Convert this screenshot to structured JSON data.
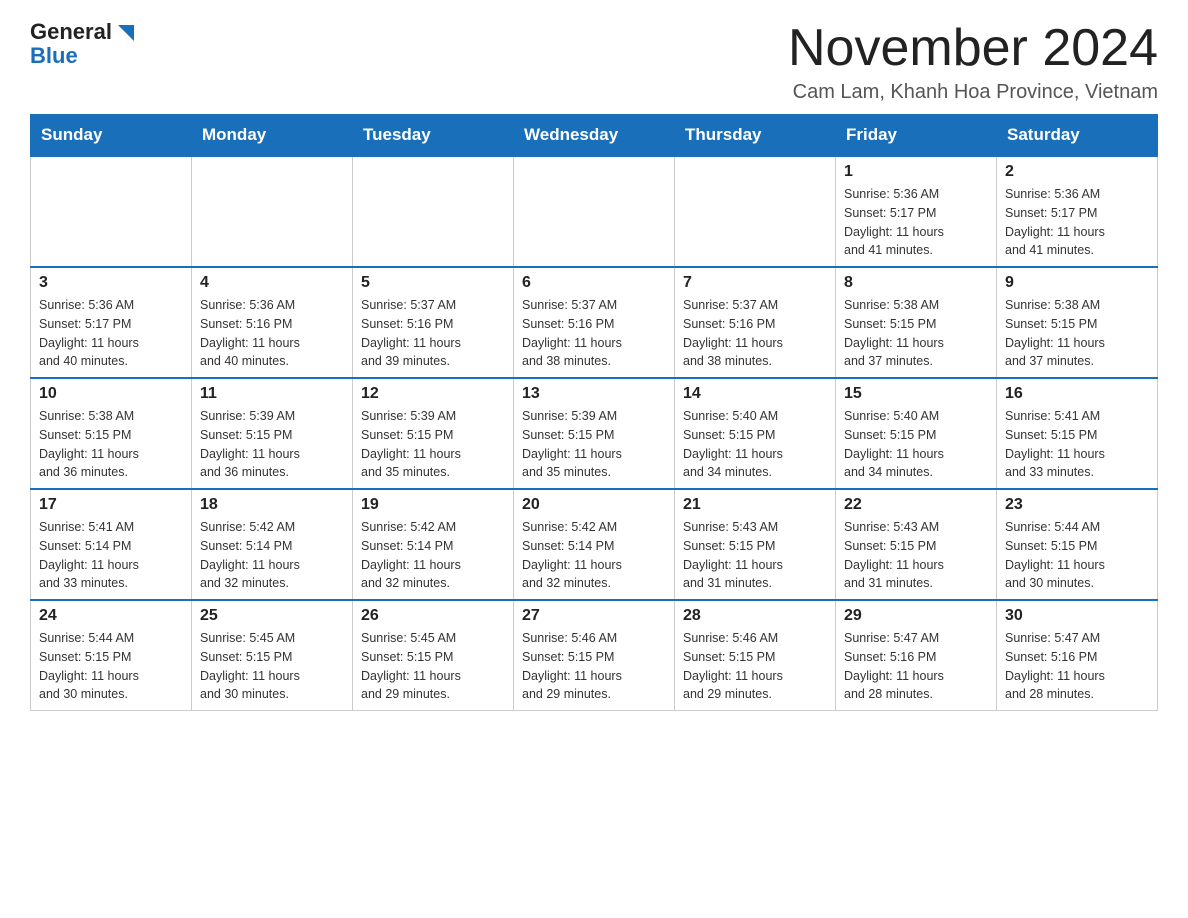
{
  "header": {
    "logo_general": "General",
    "logo_blue": "Blue",
    "month_title": "November 2024",
    "location": "Cam Lam, Khanh Hoa Province, Vietnam"
  },
  "days_of_week": [
    "Sunday",
    "Monday",
    "Tuesday",
    "Wednesday",
    "Thursday",
    "Friday",
    "Saturday"
  ],
  "weeks": [
    {
      "days": [
        {
          "date": "",
          "info": ""
        },
        {
          "date": "",
          "info": ""
        },
        {
          "date": "",
          "info": ""
        },
        {
          "date": "",
          "info": ""
        },
        {
          "date": "",
          "info": ""
        },
        {
          "date": "1",
          "info": "Sunrise: 5:36 AM\nSunset: 5:17 PM\nDaylight: 11 hours\nand 41 minutes."
        },
        {
          "date": "2",
          "info": "Sunrise: 5:36 AM\nSunset: 5:17 PM\nDaylight: 11 hours\nand 41 minutes."
        }
      ]
    },
    {
      "days": [
        {
          "date": "3",
          "info": "Sunrise: 5:36 AM\nSunset: 5:17 PM\nDaylight: 11 hours\nand 40 minutes."
        },
        {
          "date": "4",
          "info": "Sunrise: 5:36 AM\nSunset: 5:16 PM\nDaylight: 11 hours\nand 40 minutes."
        },
        {
          "date": "5",
          "info": "Sunrise: 5:37 AM\nSunset: 5:16 PM\nDaylight: 11 hours\nand 39 minutes."
        },
        {
          "date": "6",
          "info": "Sunrise: 5:37 AM\nSunset: 5:16 PM\nDaylight: 11 hours\nand 38 minutes."
        },
        {
          "date": "7",
          "info": "Sunrise: 5:37 AM\nSunset: 5:16 PM\nDaylight: 11 hours\nand 38 minutes."
        },
        {
          "date": "8",
          "info": "Sunrise: 5:38 AM\nSunset: 5:15 PM\nDaylight: 11 hours\nand 37 minutes."
        },
        {
          "date": "9",
          "info": "Sunrise: 5:38 AM\nSunset: 5:15 PM\nDaylight: 11 hours\nand 37 minutes."
        }
      ]
    },
    {
      "days": [
        {
          "date": "10",
          "info": "Sunrise: 5:38 AM\nSunset: 5:15 PM\nDaylight: 11 hours\nand 36 minutes."
        },
        {
          "date": "11",
          "info": "Sunrise: 5:39 AM\nSunset: 5:15 PM\nDaylight: 11 hours\nand 36 minutes."
        },
        {
          "date": "12",
          "info": "Sunrise: 5:39 AM\nSunset: 5:15 PM\nDaylight: 11 hours\nand 35 minutes."
        },
        {
          "date": "13",
          "info": "Sunrise: 5:39 AM\nSunset: 5:15 PM\nDaylight: 11 hours\nand 35 minutes."
        },
        {
          "date": "14",
          "info": "Sunrise: 5:40 AM\nSunset: 5:15 PM\nDaylight: 11 hours\nand 34 minutes."
        },
        {
          "date": "15",
          "info": "Sunrise: 5:40 AM\nSunset: 5:15 PM\nDaylight: 11 hours\nand 34 minutes."
        },
        {
          "date": "16",
          "info": "Sunrise: 5:41 AM\nSunset: 5:15 PM\nDaylight: 11 hours\nand 33 minutes."
        }
      ]
    },
    {
      "days": [
        {
          "date": "17",
          "info": "Sunrise: 5:41 AM\nSunset: 5:14 PM\nDaylight: 11 hours\nand 33 minutes."
        },
        {
          "date": "18",
          "info": "Sunrise: 5:42 AM\nSunset: 5:14 PM\nDaylight: 11 hours\nand 32 minutes."
        },
        {
          "date": "19",
          "info": "Sunrise: 5:42 AM\nSunset: 5:14 PM\nDaylight: 11 hours\nand 32 minutes."
        },
        {
          "date": "20",
          "info": "Sunrise: 5:42 AM\nSunset: 5:14 PM\nDaylight: 11 hours\nand 32 minutes."
        },
        {
          "date": "21",
          "info": "Sunrise: 5:43 AM\nSunset: 5:15 PM\nDaylight: 11 hours\nand 31 minutes."
        },
        {
          "date": "22",
          "info": "Sunrise: 5:43 AM\nSunset: 5:15 PM\nDaylight: 11 hours\nand 31 minutes."
        },
        {
          "date": "23",
          "info": "Sunrise: 5:44 AM\nSunset: 5:15 PM\nDaylight: 11 hours\nand 30 minutes."
        }
      ]
    },
    {
      "days": [
        {
          "date": "24",
          "info": "Sunrise: 5:44 AM\nSunset: 5:15 PM\nDaylight: 11 hours\nand 30 minutes."
        },
        {
          "date": "25",
          "info": "Sunrise: 5:45 AM\nSunset: 5:15 PM\nDaylight: 11 hours\nand 30 minutes."
        },
        {
          "date": "26",
          "info": "Sunrise: 5:45 AM\nSunset: 5:15 PM\nDaylight: 11 hours\nand 29 minutes."
        },
        {
          "date": "27",
          "info": "Sunrise: 5:46 AM\nSunset: 5:15 PM\nDaylight: 11 hours\nand 29 minutes."
        },
        {
          "date": "28",
          "info": "Sunrise: 5:46 AM\nSunset: 5:15 PM\nDaylight: 11 hours\nand 29 minutes."
        },
        {
          "date": "29",
          "info": "Sunrise: 5:47 AM\nSunset: 5:16 PM\nDaylight: 11 hours\nand 28 minutes."
        },
        {
          "date": "30",
          "info": "Sunrise: 5:47 AM\nSunset: 5:16 PM\nDaylight: 11 hours\nand 28 minutes."
        }
      ]
    }
  ]
}
